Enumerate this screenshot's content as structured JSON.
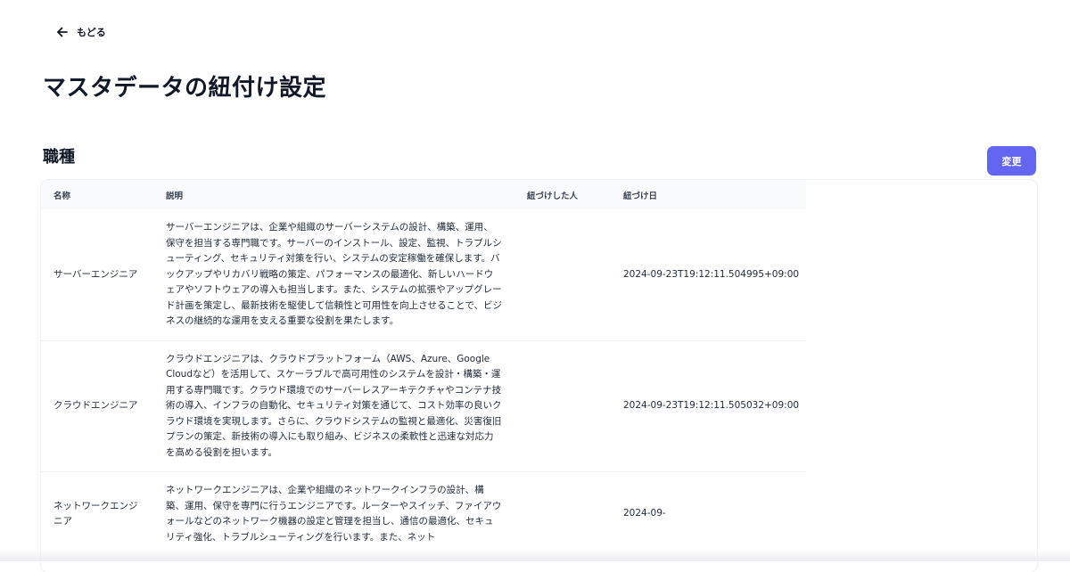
{
  "nav": {
    "back_label": "もどる"
  },
  "page": {
    "title": "マスタデータの紐付け設定"
  },
  "section": {
    "title": "職種",
    "change_button_label": "変更"
  },
  "table": {
    "headers": [
      "名称",
      "説明",
      "紐づけした人",
      "紐づけ日"
    ],
    "rows": [
      {
        "name": "サーバーエンジニア",
        "description": "サーバーエンジニアは、企業や組織のサーバーシステムの設計、構築、運用、保守を担当する専門職です。サーバーのインストール、設定、監視、トラブルシューティング、セキュリティ対策を行い、システムの安定稼働を確保します。バックアップやリカバリ戦略の策定、パフォーマンスの最適化、新しいハードウェアやソフトウェアの導入も担当します。また、システムの拡張やアップグレード計画を策定し、最新技術を駆使して信頼性と可用性を向上させることで、ビジネスの継続的な運用を支える重要な役割を果たします。",
        "linked_by": "",
        "linked_at": "2024-09-23T19:12:11.504995+09:00"
      },
      {
        "name": "クラウドエンジニア",
        "description": "クラウドエンジニアは、クラウドプラットフォーム（AWS、Azure、Google Cloudなど）を活用して、スケーラブルで高可用性のシステムを設計・構築・運用する専門職です。クラウド環境でのサーバーレスアーキテクチャやコンテナ技術の導入、インフラの自動化、セキュリティ対策を通じて、コスト効率の良いクラウド環境を実現します。さらに、クラウドシステムの監視と最適化、災害復旧プランの策定、新技術の導入にも取り組み、ビジネスの柔軟性と迅速な対応力を高める役割を担います。",
        "linked_by": "",
        "linked_at": "2024-09-23T19:12:11.505032+09:00"
      },
      {
        "name": "ネットワークエンジニア",
        "description": "ネットワークエンジニアは、企業や組織のネットワークインフラの設計、構築、運用、保守を専門に行うエンジニアです。ルーターやスイッチ、ファイアウォールなどのネットワーク機器の設定と管理を担当し、通信の最適化、セキュリティ強化、トラブルシューティングを行います。また、ネット",
        "linked_by": "",
        "linked_at": "2024-09-"
      }
    ]
  },
  "colors": {
    "accent": "#6366f1",
    "header_bg": "#f9fafb",
    "text": "#111827"
  },
  "icons": {
    "back": "arrow-left-icon"
  }
}
